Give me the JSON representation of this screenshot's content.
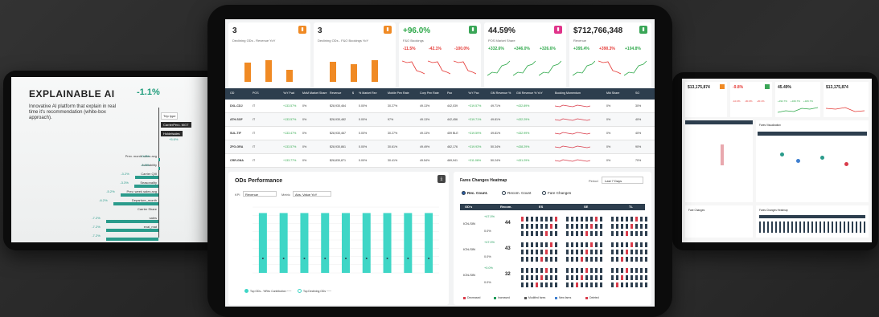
{
  "left_tablet": {
    "title": "EXPLAINABLE AI",
    "value": "-1.1%",
    "description": "Innovative AI platform that explain in real time it's recommendation (white-box approach).",
    "chips": [
      "Trip type",
      "CarrierPerc. MGT",
      "Holdelsales",
      "+5.6%"
    ],
    "features": [
      {
        "label": "Prev. month sales avg",
        "pct": "-0.2%",
        "value": 0.2,
        "side": "right"
      },
      {
        "label": "Availability",
        "pct": "-0.2%",
        "value": 0.2,
        "side": "right"
      },
      {
        "label": "Carrier QIII",
        "pct": "-3.2%",
        "value": 3.2,
        "side": "left"
      },
      {
        "label": "Seasonality",
        "pct": "-3.3%",
        "value": 3.3,
        "side": "left"
      },
      {
        "label": "Prev. week sales avg",
        "pct": "-5.2%",
        "value": 5.2,
        "side": "left"
      },
      {
        "label": "Departure_month",
        "pct": "-6.2%",
        "value": 6.2,
        "side": "left"
      },
      {
        "label": "Carrier Share",
        "pct": "",
        "value": 0,
        "side": "left"
      },
      {
        "label": "sales",
        "pct": "-7.2%",
        "value": 7.2,
        "side": "left"
      },
      {
        "label": "eval_mat",
        "pct": "-7.2%",
        "value": 7.2,
        "side": "left"
      },
      {
        "label": "",
        "pct": "-7.2%",
        "value": 7.2,
        "side": "left"
      }
    ]
  },
  "center": {
    "kpis": [
      {
        "big": "3",
        "sub": "Declining ODs - Revenue YoY",
        "icon_color": "#f08a24",
        "minis": [],
        "bars": [
          0.8,
          0.9,
          0.5
        ]
      },
      {
        "big": "3",
        "sub": "Declining ODs - F&O Bookings YoY",
        "icon_color": "#f08a24",
        "minis": [],
        "bars": [
          0.85,
          0.75,
          0.9
        ]
      },
      {
        "big": "+96.0%",
        "sub": "F&O Bookings",
        "icon_color": "#3aa657",
        "minis": [
          "-11.5%",
          "-42.1%",
          "-100.0%"
        ],
        "mini_colors": [
          "#e53935",
          "#e53935",
          "#e53935"
        ]
      },
      {
        "big": "44.59%",
        "sub": "POS Market Share",
        "icon_color": "#e0338a",
        "minis": [
          "+332.6%",
          "+346.0%",
          "+326.6%"
        ],
        "mini_colors": [
          "#2ea84a",
          "#2ea84a",
          "#2ea84a"
        ]
      },
      {
        "big": "$712,766,348",
        "sub": "Revenue",
        "icon_color": "#3aa657",
        "minis": [
          "+395.4%",
          "+390.3%",
          "+104.8%"
        ],
        "mini_colors": [
          "#2ea84a",
          "#e53935",
          "#2ea84a"
        ]
      }
    ],
    "table": {
      "headers": [
        "OD",
        "POS",
        "YoY Fwd",
        "MoM Market Share",
        "Revenue",
        "$",
        "% Market Rev",
        "Mobile Pen Rate",
        "Corp Pen Rate",
        "Pax",
        "YoY Pax",
        "GM Revenue %",
        "GM Revenue % YoY",
        "Booking Momentum",
        "Mkt Share",
        "SO"
      ],
      "rows": [
        [
          "DXL-CDJ",
          "IT",
          "+133.57%",
          "0%",
          "$28,930,464",
          "",
          "0.00%",
          "30.27%",
          "49.13%",
          "442,039",
          "+319.57%",
          "49.71%",
          "+432.89%",
          "",
          "0%",
          "30%"
        ],
        [
          "ATH-SOF",
          "IT",
          "+133.57%",
          "0%",
          "$28,930,482",
          "",
          "0.00%",
          "97%",
          "49.13%",
          "442,456",
          "+319.71%",
          "49.81%",
          "+432.29%",
          "",
          "0%",
          "40%"
        ],
        [
          "SUL-TIF",
          "IT",
          "+133.47%",
          "0%",
          "$28,930,467",
          "",
          "0.00%",
          "30.27%",
          "49.13%",
          "459 BLE",
          "+319.59%",
          "49.81%",
          "+432.99%",
          "",
          "0%",
          "40%"
        ],
        [
          "ZFG-GRA",
          "IT",
          "+133.57%",
          "0%",
          "$28,930,861",
          "",
          "0.00%",
          "30.61%",
          "49.49%",
          "462,176",
          "+319.93%",
          "50.34%",
          "+438.29%",
          "",
          "0%",
          "90%"
        ],
        [
          "CRR-GNA",
          "IT",
          "+133.77%",
          "0%",
          "$28,830,871",
          "",
          "0.00%",
          "30.41%",
          "49.54%",
          "469,941",
          "+311.06%",
          "50.24%",
          "+431.29%",
          "",
          "0%",
          "70%"
        ]
      ]
    },
    "ods_panel": {
      "title": "ODs Performance",
      "filter1_label": "KPI",
      "filter1_value": "Revenue",
      "filter2_label": "Metric",
      "filter2_value": "Abs. Value YoY",
      "legend": [
        "Top ODs - %Rev Contribution ~~~",
        "Top Declining ODs ~~~"
      ]
    },
    "heatmap_panel": {
      "title": "Fares Changes Heatmap",
      "period_label": "Period",
      "period_value": "Last 7 Days",
      "radios": [
        "Rec. Count.",
        "Recom. Count",
        "Fare Changes"
      ],
      "header": [
        "OD's",
        "Recom.",
        "ES",
        "SE",
        "TL"
      ],
      "rows": [
        {
          "od": "ICN-SIN",
          "n": "44",
          "pct": "+47.0%",
          "pct2": "0.0%"
        },
        {
          "od": "ICN-SIN",
          "n": "43",
          "pct": "+47.0%",
          "pct2": "0.0%"
        },
        {
          "od": "ICN-SIN",
          "n": "32",
          "pct": "+0.0%",
          "pct2": "0.0%"
        }
      ],
      "legend": [
        "Decreased",
        "Increased",
        "Modified fares",
        "New fares",
        "Deleted"
      ]
    }
  },
  "right_tablet": {
    "kpis": [
      "$13,175,874",
      "-9.8%",
      "45.49%",
      "$13,175,874"
    ],
    "minis": [
      "-10.0%",
      "-30.0%",
      "-20.1%",
      "+332.7%",
      "+346.7%",
      "+326.7%"
    ],
    "panels": [
      "Fares Visualization",
      "Fare Changes",
      "Fares Changes Heatmap"
    ]
  },
  "chart_data": {
    "type": "bar",
    "categories": [
      "",
      "",
      "",
      "",
      "",
      "",
      "",
      "",
      ""
    ],
    "values": [
      5.0,
      5.0,
      5.0,
      5.0,
      5.0,
      5.0,
      5.0,
      5.0,
      5.0
    ],
    "ylim": [
      0,
      5.5
    ],
    "xlabel": "",
    "ylabel": "",
    "title": ""
  }
}
